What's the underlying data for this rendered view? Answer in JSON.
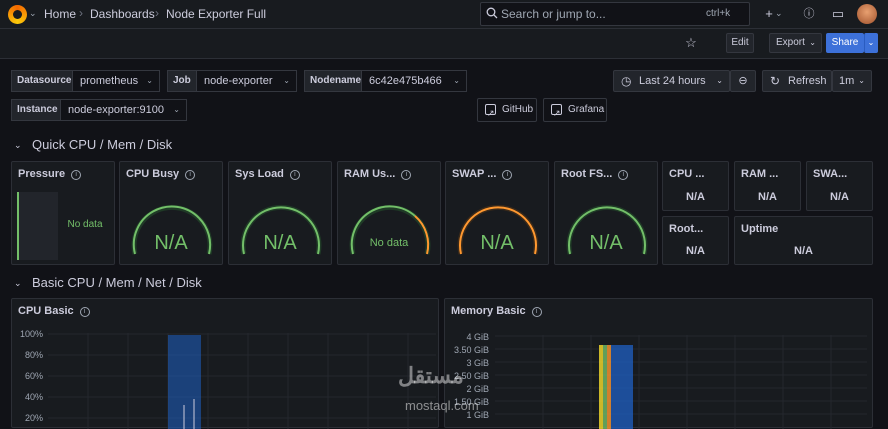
{
  "breadcrumb": {
    "home": "Home",
    "dashboards": "Dashboards",
    "current": "Node Exporter Full"
  },
  "search": {
    "placeholder": "Search or jump to...",
    "shortcut": "ctrl+k"
  },
  "toolbar": {
    "edit": "Edit",
    "export": "Export",
    "share": "Share"
  },
  "variables": [
    {
      "label": "Datasource",
      "value": "prometheus"
    },
    {
      "label": "Job",
      "value": "node-exporter"
    },
    {
      "label": "Nodename",
      "value": "6c42e475b466"
    },
    {
      "label": "Instance",
      "value": "node-exporter:9100"
    }
  ],
  "links": {
    "github": "GitHub",
    "grafana": "Grafana"
  },
  "time": {
    "range": "Last 24 hours",
    "refresh": "Refresh",
    "interval": "1m"
  },
  "rows": {
    "quick": "Quick CPU / Mem / Disk",
    "basic": "Basic CPU / Mem / Net / Disk"
  },
  "panels": {
    "pressure": {
      "title": "Pressure",
      "status": "No data"
    },
    "cpu_busy": {
      "title": "CPU Busy",
      "value": "N/A"
    },
    "sys_load": {
      "title": "Sys Load",
      "value": "N/A"
    },
    "ram_used": {
      "title": "RAM Us...",
      "status": "No data"
    },
    "swap_used": {
      "title": "SWAP ...",
      "value": "N/A"
    },
    "root_fs": {
      "title": "Root FS...",
      "value": "N/A"
    },
    "cpu_cores": {
      "title": "CPU ...",
      "value": "N/A"
    },
    "ram_total": {
      "title": "RAM ...",
      "value": "N/A"
    },
    "swap_total": {
      "title": "SWA...",
      "value": "N/A"
    },
    "rootfs_total": {
      "title": "Root...",
      "value": "N/A"
    },
    "uptime": {
      "title": "Uptime",
      "value": "N/A"
    },
    "cpu_basic": {
      "title": "CPU Basic",
      "yticks": [
        "100%",
        "80%",
        "60%",
        "40%",
        "20%"
      ]
    },
    "memory_basic": {
      "title": "Memory Basic",
      "yticks": [
        "4 GiB",
        "3.50 GiB",
        "3 GiB",
        "2.50 GiB",
        "2 GiB",
        "1.50 GiB",
        "1 GiB"
      ]
    }
  },
  "watermark": "mostaql.com",
  "colors": {
    "ok": "#73bf69",
    "warn": "#ff9830",
    "accent": "#3d71d9"
  }
}
